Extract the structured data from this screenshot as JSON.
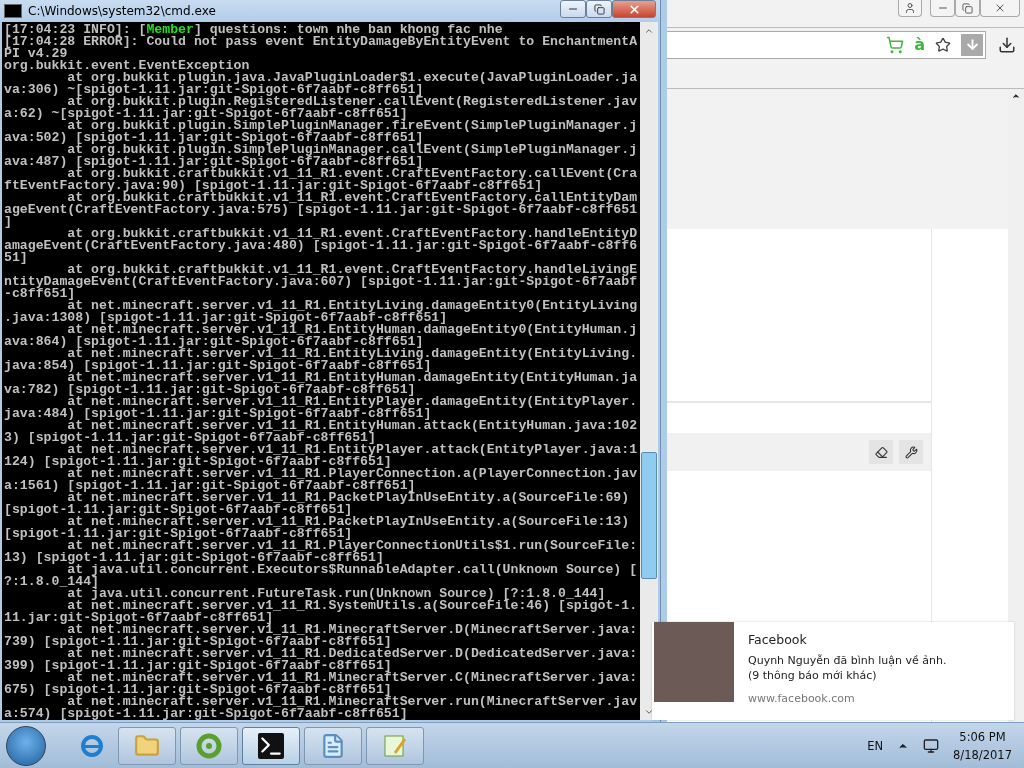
{
  "console_window": {
    "title": "C:\\Windows\\system32\\cmd.exe",
    "chat_line": {
      "prefix": "[17:04:23 INFO]: [",
      "rank": "Member",
      "message": "] questions: town nhe ban khong fac nhe"
    },
    "lines": [
      "[17:04:28 ERROR]: Could not pass event EntityDamageByEntityEvent to EnchantmentA",
      "PI v4.29",
      "org.bukkit.event.EventException",
      "        at org.bukkit.plugin.java.JavaPluginLoader$1.execute(JavaPluginLoader.ja",
      "va:306) ~[spigot-1.11.jar:git-Spigot-6f7aabf-c8ff651]",
      "        at org.bukkit.plugin.RegisteredListener.callEvent(RegisteredListener.jav",
      "a:62) ~[spigot-1.11.jar:git-Spigot-6f7aabf-c8ff651]",
      "        at org.bukkit.plugin.SimplePluginManager.fireEvent(SimplePluginManager.j",
      "ava:502) [spigot-1.11.jar:git-Spigot-6f7aabf-c8ff651]",
      "        at org.bukkit.plugin.SimplePluginManager.callEvent(SimplePluginManager.j",
      "ava:487) [spigot-1.11.jar:git-Spigot-6f7aabf-c8ff651]",
      "        at org.bukkit.craftbukkit.v1_11_R1.event.CraftEventFactory.callEvent(Cra",
      "ftEventFactory.java:90) [spigot-1.11.jar:git-Spigot-6f7aabf-c8ff651]",
      "        at org.bukkit.craftbukkit.v1_11_R1.event.CraftEventFactory.callEntityDam",
      "ageEvent(CraftEventFactory.java:575) [spigot-1.11.jar:git-Spigot-6f7aabf-c8ff651",
      "]",
      "        at org.bukkit.craftbukkit.v1_11_R1.event.CraftEventFactory.handleEntityD",
      "amageEvent(CraftEventFactory.java:480) [spigot-1.11.jar:git-Spigot-6f7aabf-c8ff6",
      "51]",
      "        at org.bukkit.craftbukkit.v1_11_R1.event.CraftEventFactory.handleLivingE",
      "ntityDamageEvent(CraftEventFactory.java:607) [spigot-1.11.jar:git-Spigot-6f7aabf",
      "-c8ff651]",
      "        at net.minecraft.server.v1_11_R1.EntityLiving.damageEntity0(EntityLiving",
      ".java:1308) [spigot-1.11.jar:git-Spigot-6f7aabf-c8ff651]",
      "        at net.minecraft.server.v1_11_R1.EntityHuman.damageEntity0(EntityHuman.j",
      "ava:864) [spigot-1.11.jar:git-Spigot-6f7aabf-c8ff651]",
      "        at net.minecraft.server.v1_11_R1.EntityLiving.damageEntity(EntityLiving.",
      "java:854) [spigot-1.11.jar:git-Spigot-6f7aabf-c8ff651]",
      "        at net.minecraft.server.v1_11_R1.EntityHuman.damageEntity(EntityHuman.ja",
      "va:782) [spigot-1.11.jar:git-Spigot-6f7aabf-c8ff651]",
      "        at net.minecraft.server.v1_11_R1.EntityPlayer.damageEntity(EntityPlayer.",
      "java:484) [spigot-1.11.jar:git-Spigot-6f7aabf-c8ff651]",
      "        at net.minecraft.server.v1_11_R1.EntityHuman.attack(EntityHuman.java:102",
      "3) [spigot-1.11.jar:git-Spigot-6f7aabf-c8ff651]",
      "        at net.minecraft.server.v1_11_R1.EntityPlayer.attack(EntityPlayer.java:1",
      "124) [spigot-1.11.jar:git-Spigot-6f7aabf-c8ff651]",
      "        at net.minecraft.server.v1_11_R1.PlayerConnection.a(PlayerConnection.jav",
      "a:1561) [spigot-1.11.jar:git-Spigot-6f7aabf-c8ff651]",
      "        at net.minecraft.server.v1_11_R1.PacketPlayInUseEntity.a(SourceFile:69)",
      "[spigot-1.11.jar:git-Spigot-6f7aabf-c8ff651]",
      "        at net.minecraft.server.v1_11_R1.PacketPlayInUseEntity.a(SourceFile:13)",
      "[spigot-1.11.jar:git-Spigot-6f7aabf-c8ff651]",
      "        at net.minecraft.server.v1_11_R1.PlayerConnectionUtils$1.run(SourceFile:",
      "13) [spigot-1.11.jar:git-Spigot-6f7aabf-c8ff651]",
      "        at java.util.concurrent.Executors$RunnableAdapter.call(Unknown Source) [",
      "?:1.8.0_144]",
      "        at java.util.concurrent.FutureTask.run(Unknown Source) [?:1.8.0_144]",
      "        at net.minecraft.server.v1_11_R1.SystemUtils.a(SourceFile:46) [spigot-1.",
      "11.jar:git-Spigot-6f7aabf-c8ff651]",
      "        at net.minecraft.server.v1_11_R1.MinecraftServer.D(MinecraftServer.java:",
      "739) [spigot-1.11.jar:git-Spigot-6f7aabf-c8ff651]",
      "        at net.minecraft.server.v1_11_R1.DedicatedServer.D(DedicatedServer.java:",
      "399) [spigot-1.11.jar:git-Spigot-6f7aabf-c8ff651]",
      "        at net.minecraft.server.v1_11_R1.MinecraftServer.C(MinecraftServer.java:",
      "675) [spigot-1.11.jar:git-Spigot-6f7aabf-c8ff651]",
      "        at net.minecraft.server.v1_11_R1.MinecraftServer.run(MinecraftServer.jav",
      "a:574) [spigot-1.11.jar:git-Spigot-6f7aabf-c8ff651]"
    ]
  },
  "browser": {
    "extension_label": "à"
  },
  "notification": {
    "app": "Facebook",
    "message": "Quynh Nguyễn đã bình luận về ảnh.",
    "more": "(9 thông báo mới khác)",
    "source": "www.facebook.com"
  },
  "taskbar": {
    "buttons": [
      {
        "kind": "folder",
        "selected": false
      },
      {
        "kind": "app",
        "selected": false
      },
      {
        "kind": "console",
        "selected": true
      },
      {
        "kind": "notepad",
        "selected": false
      },
      {
        "kind": "editor",
        "selected": false
      }
    ],
    "language": "EN",
    "time": "5:06 PM",
    "date": "8/18/2017"
  }
}
